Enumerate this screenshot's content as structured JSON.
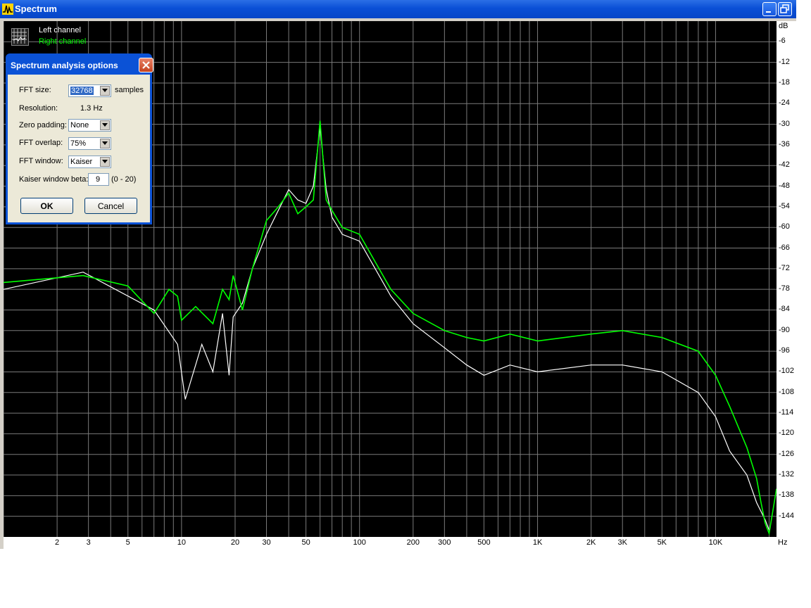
{
  "window": {
    "title": "Spectrum"
  },
  "legend": {
    "left": "Left channel",
    "right": "Right channel"
  },
  "colors": {
    "left": "#ffffff",
    "right": "#00ff00",
    "grid": "#7a7a7a",
    "titlebar": "#0a4fd6"
  },
  "y_axis": {
    "unit": "dB",
    "ticks": [
      "-6",
      "-12",
      "-18",
      "-24",
      "-30",
      "-36",
      "-42",
      "-48",
      "-54",
      "-60",
      "-66",
      "-72",
      "-78",
      "-84",
      "-90",
      "-96",
      "-102",
      "-108",
      "-114",
      "-120",
      "-126",
      "-132",
      "-138",
      "-144"
    ]
  },
  "x_axis": {
    "unit": "Hz",
    "ticks": [
      "2",
      "3",
      "5",
      "10",
      "20",
      "30",
      "50",
      "100",
      "200",
      "300",
      "500",
      "1K",
      "2K",
      "3K",
      "5K",
      "10K"
    ]
  },
  "dialog": {
    "title": "Spectrum analysis options",
    "fft_size_label": "FFT size:",
    "fft_size_value": "32768",
    "fft_size_unit": "samples",
    "resolution_label": "Resolution:",
    "resolution_value": "1.3 Hz",
    "zero_padding_label": "Zero padding:",
    "zero_padding_value": "None",
    "fft_overlap_label": "FFT overlap:",
    "fft_overlap_value": "75%",
    "fft_window_label": "FFT window:",
    "fft_window_value": "Kaiser",
    "beta_label": "Kaiser window beta:",
    "beta_value": "9",
    "beta_range": "(0 - 20)",
    "ok_label": "OK",
    "cancel_label": "Cancel"
  },
  "chart_data": {
    "type": "line",
    "xscale": "log",
    "xlim": [
      1,
      22000
    ],
    "ylim": [
      -150,
      0
    ],
    "grid": true,
    "legend": "top-left",
    "series": [
      {
        "name": "Left channel",
        "x": [
          1,
          2.8,
          7,
          9.5,
          10.5,
          13,
          15,
          17,
          18.5,
          19.5,
          22,
          25,
          30,
          35,
          40,
          45,
          50,
          55,
          60,
          65,
          70,
          80,
          100,
          150,
          200,
          300,
          400,
          500,
          700,
          1000,
          2000,
          3000,
          5000,
          8000,
          10000,
          12000,
          15000,
          17000,
          19000,
          20000
        ],
        "y": [
          -78,
          -73,
          -84,
          -94,
          -110,
          -94,
          -102,
          -85,
          -103,
          -86,
          -82,
          -72,
          -62,
          -55,
          -49,
          -52,
          -53,
          -48,
          -31,
          -49,
          -57,
          -62,
          -64,
          -80,
          -88,
          -95,
          -100,
          -103,
          -100,
          -102,
          -100,
          -100,
          -102,
          -108,
          -115,
          -125,
          -132,
          -140,
          -145,
          -148
        ]
      },
      {
        "name": "Right channel",
        "x": [
          1,
          2.8,
          5,
          7,
          8.5,
          9.5,
          10,
          12,
          15,
          17,
          18.5,
          19.5,
          22,
          25,
          30,
          35,
          40,
          45,
          50,
          55,
          60,
          65,
          70,
          80,
          100,
          150,
          200,
          300,
          400,
          500,
          700,
          1000,
          2000,
          3000,
          5000,
          8000,
          10000,
          12000,
          15000,
          17000,
          18000,
          19000,
          20000,
          22000
        ],
        "y": [
          -76,
          -74,
          -77,
          -85,
          -78,
          -80,
          -87,
          -83,
          -88,
          -78,
          -81,
          -74,
          -84,
          -72,
          -58,
          -54,
          -50,
          -56,
          -54,
          -52,
          -29,
          -52,
          -55,
          -60,
          -62,
          -78,
          -85,
          -90,
          -92,
          -93,
          -91,
          -93,
          -91,
          -90,
          -92,
          -96,
          -103,
          -112,
          -124,
          -133,
          -140,
          -146,
          -149,
          -136
        ]
      }
    ]
  }
}
